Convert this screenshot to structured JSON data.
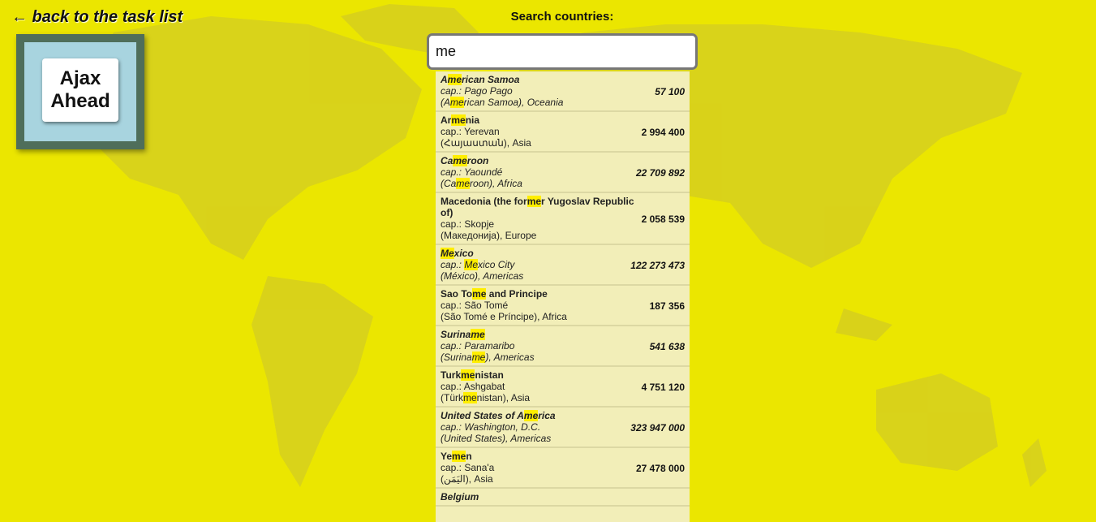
{
  "back_link": "← back to the task list",
  "logo": "Ajax\nAhead",
  "search": {
    "label": "Search countries:",
    "value": "me",
    "highlight": "me"
  },
  "results": [
    {
      "name": "American Samoa",
      "capital": "cap.: Pago Pago",
      "native": "(American Samoa),",
      "region": "Oceania",
      "population": "57 100",
      "italic": true
    },
    {
      "name": "Armenia",
      "capital": "cap.: Yerevan",
      "native": "(Հայաստան),",
      "region": "Asia",
      "population": "2 994 400",
      "italic": false
    },
    {
      "name": "Cameroon",
      "capital": "cap.: Yaoundé",
      "native": "(Cameroon),",
      "region": "Africa",
      "population": "22 709 892",
      "italic": true
    },
    {
      "name": "Macedonia (the former Yugoslav Republic of)",
      "capital": "cap.: Skopje",
      "native": "(Македонија),",
      "region": "Europe",
      "population": "2 058 539",
      "italic": false
    },
    {
      "name": "Mexico",
      "capital": "cap.: Mexico City",
      "native": "(México),",
      "region": "Americas",
      "population": "122 273 473",
      "italic": true
    },
    {
      "name": "Sao Tome and Principe",
      "capital": "cap.: São Tomé",
      "native": "(São Tomé e Príncipe),",
      "region": "Africa",
      "population": "187 356",
      "italic": false
    },
    {
      "name": "Suriname",
      "capital": "cap.: Paramaribo",
      "native": "(Suriname),",
      "region": "Americas",
      "population": "541 638",
      "italic": true
    },
    {
      "name": "Turkmenistan",
      "capital": "cap.: Ashgabat",
      "native": "(Türkmenistan),",
      "region": "Asia",
      "population": "4 751 120",
      "italic": false
    },
    {
      "name": "United States of America",
      "capital": "cap.: Washington, D.C.",
      "native": "(United States),",
      "region": "Americas",
      "population": "323 947 000",
      "italic": true
    },
    {
      "name": "Yemen",
      "capital": "cap.: Sana'a",
      "native": "(اليَمَن),",
      "region": "Asia",
      "population": "27 478 000",
      "italic": false
    },
    {
      "name": "Belgium",
      "capital": "",
      "native": "",
      "region": "",
      "population": "",
      "italic": true
    }
  ]
}
